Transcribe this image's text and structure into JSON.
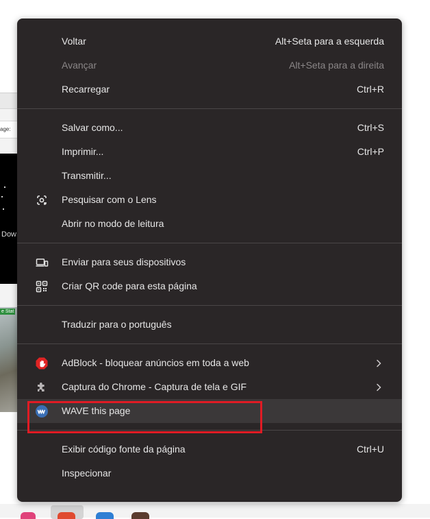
{
  "background": {
    "field_text": "age:",
    "dark_text": "Dow",
    "status_text": "e Stat"
  },
  "menu": {
    "sections": [
      [
        {
          "label": "Voltar",
          "shortcut": "Alt+Seta para a esquerda",
          "disabled": false
        },
        {
          "label": "Avançar",
          "shortcut": "Alt+Seta para a direita",
          "disabled": true
        },
        {
          "label": "Recarregar",
          "shortcut": "Ctrl+R",
          "disabled": false
        }
      ],
      [
        {
          "label": "Salvar como...",
          "shortcut": "Ctrl+S"
        },
        {
          "label": "Imprimir...",
          "shortcut": "Ctrl+P"
        },
        {
          "label": "Transmitir..."
        },
        {
          "label": "Pesquisar com o Lens",
          "icon": "lens-icon"
        },
        {
          "label": "Abrir no modo de leitura"
        }
      ],
      [
        {
          "label": "Enviar para seus dispositivos",
          "icon": "devices-icon"
        },
        {
          "label": "Criar QR code para esta página",
          "icon": "qr-code-icon"
        }
      ],
      [
        {
          "label": "Traduzir para o português"
        }
      ],
      [
        {
          "label": "AdBlock - bloquear anúncios em toda a web",
          "icon": "adblock-icon",
          "submenu": true
        },
        {
          "label": "Captura do Chrome - Captura de tela e GIF",
          "icon": "puzzle-extension-icon",
          "submenu": true
        },
        {
          "label": "WAVE this page",
          "icon": "wave-icon",
          "highlighted": true
        }
      ],
      [
        {
          "label": "Exibir código fonte da página",
          "shortcut": "Ctrl+U"
        },
        {
          "label": "Inspecionar"
        }
      ]
    ]
  },
  "colors": {
    "menu_background": "#2a2627",
    "highlight": "#3b3839",
    "text": "#e6e6e6",
    "disabled_text": "#8a8687",
    "annotation_red": "#e01b24",
    "adblock_red": "#e02424",
    "wave_blue": "#3a6fb5"
  }
}
